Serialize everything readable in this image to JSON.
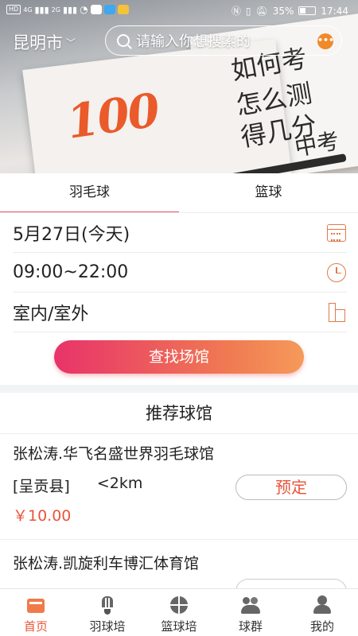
{
  "status_bar": {
    "network_badges": [
      "HD",
      "4G",
      "2G"
    ],
    "battery": "35%",
    "time": "17:44"
  },
  "header": {
    "city": "昆明市",
    "search_placeholder": "请输入你想搜素的",
    "hero_number": "100",
    "hero_handwriting": [
      "如何考",
      "怎么测",
      "得几分",
      "中考"
    ]
  },
  "tabs": [
    {
      "label": "羽毛球",
      "active": true
    },
    {
      "label": "篮球",
      "active": false
    }
  ],
  "form": {
    "date": "5月27日(今天)",
    "time": "09:00~22:00",
    "venue_type": "室内/室外",
    "search_button": "查找场馆"
  },
  "recommended": {
    "title": "推荐球馆",
    "venues": [
      {
        "name": "张松涛.华飞名盛世界羽毛球馆",
        "district": "[呈贡县]",
        "distance": "<2km",
        "price": "￥10.00",
        "action": "预定"
      },
      {
        "name": "张松涛.凯旋利车博汇体育馆"
      }
    ]
  },
  "bottom_nav": [
    {
      "label": "首页",
      "icon": "home-icon",
      "active": true
    },
    {
      "label": "羽球培",
      "icon": "shuttlecock-icon",
      "active": false
    },
    {
      "label": "篮球培",
      "icon": "basketball-icon",
      "active": false
    },
    {
      "label": "球群",
      "icon": "group-icon",
      "active": false
    },
    {
      "label": "我的",
      "icon": "profile-icon",
      "active": false
    }
  ],
  "colors": {
    "accent": "#e8553a",
    "button_gradient_start": "#e8336a",
    "button_gradient_end": "#f59a5a",
    "icon_orange": "#e07a4a"
  }
}
